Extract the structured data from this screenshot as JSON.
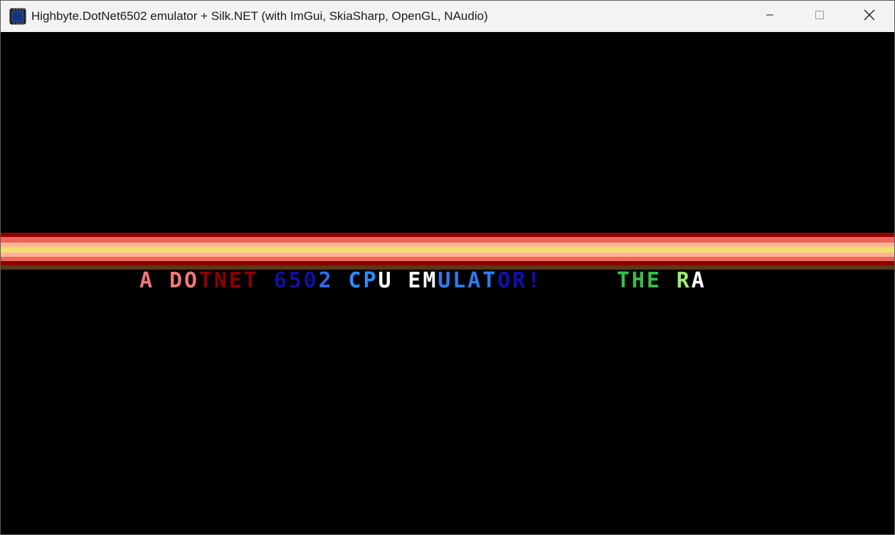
{
  "window": {
    "title": "Highbyte.DotNet6502 emulator + Silk.NET (with ImGui, SkiaSharp, OpenGL, NAudio)",
    "icons": {
      "app": "chip-icon",
      "minimize": "minimize-icon",
      "maximize": "maximize-icon",
      "close": "close-icon"
    }
  },
  "screen": {
    "background": "#000000",
    "raster_bar_colors": [
      "#8b0000",
      "#e8685a",
      "#ffb39a",
      "#f0e070",
      "#ffb39a",
      "#e8685a",
      "#8b0000",
      "#5a3818"
    ],
    "scroll_text": [
      {
        "text": "A ",
        "color": "#f07878"
      },
      {
        "text": "DO",
        "color": "#f07878"
      },
      {
        "text": "TNET",
        "color": "#8c0000"
      },
      {
        "text": " ",
        "color": "#000000"
      },
      {
        "text": "650",
        "color": "#1010a0"
      },
      {
        "text": "2",
        "color": "#2c6cf0"
      },
      {
        "text": " ",
        "color": "#000000"
      },
      {
        "text": "CP",
        "color": "#2c8cff"
      },
      {
        "text": "U",
        "color": "#ffffff"
      },
      {
        "text": " ",
        "color": "#000000"
      },
      {
        "text": "EM",
        "color": "#ffffff"
      },
      {
        "text": "ULAT",
        "color": "#2c7cf0"
      },
      {
        "text": "OR!",
        "color": "#1010b0"
      },
      {
        "text": "     ",
        "color": "#000000"
      },
      {
        "text": "THE",
        "color": "#34c04c"
      },
      {
        "text": " ",
        "color": "#000000"
      },
      {
        "text": "R",
        "color": "#9cf070"
      },
      {
        "text": "A",
        "color": "#ffffff"
      }
    ]
  }
}
